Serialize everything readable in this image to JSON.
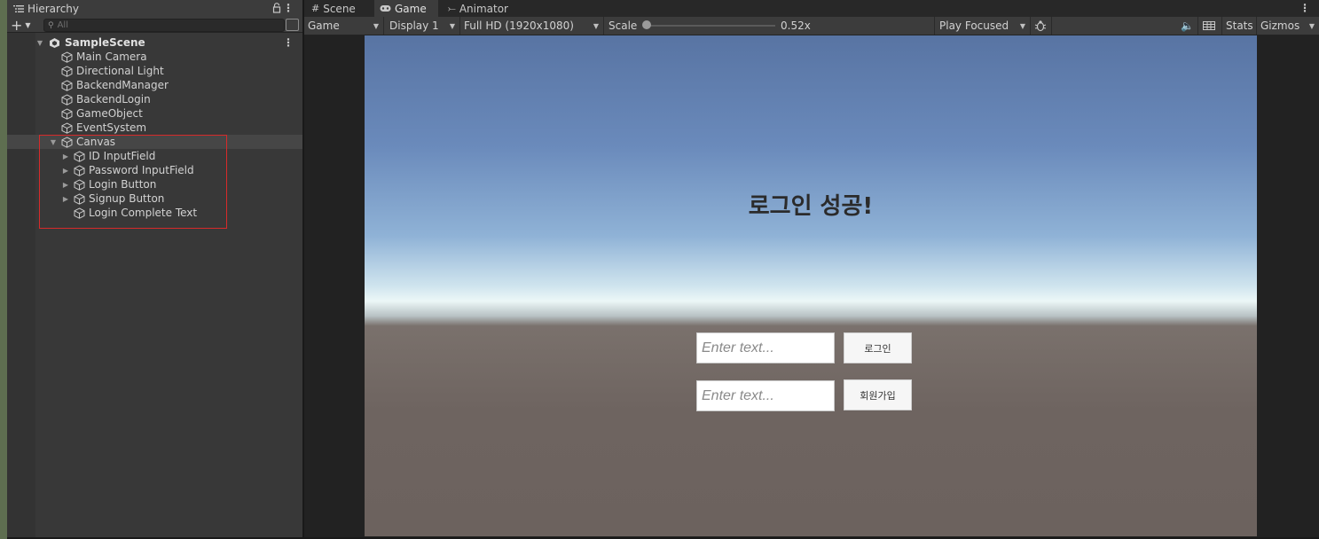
{
  "hierarchy": {
    "tab_label": "Hierarchy",
    "search_placeholder": "All",
    "scene": "SampleScene",
    "items": [
      {
        "label": "Main Camera"
      },
      {
        "label": "Directional Light"
      },
      {
        "label": "BackendManager"
      },
      {
        "label": "BackendLogin"
      },
      {
        "label": "GameObject"
      },
      {
        "label": "EventSystem"
      },
      {
        "label": "Canvas"
      }
    ],
    "canvas_children": [
      {
        "label": "ID InputField"
      },
      {
        "label": "Password InputField"
      },
      {
        "label": "Login Button"
      },
      {
        "label": "Signup Button"
      },
      {
        "label": "Login Complete Text"
      }
    ]
  },
  "tabs": {
    "scene": "Scene",
    "game": "Game",
    "animator": "Animator"
  },
  "toolbar": {
    "view_mode": "Game",
    "display": "Display 1",
    "resolution": "Full HD (1920x1080)",
    "scale_label": "Scale",
    "scale_value": "0.52x",
    "scale_fraction": 0.0,
    "play_mode": "Play Focused",
    "stats": "Stats",
    "gizmos": "Gizmos"
  },
  "game": {
    "title": "로그인 성공!",
    "id_placeholder": "Enter text...",
    "password_placeholder": "Enter text...",
    "login_button": "로그인",
    "signup_button": "회원가입"
  },
  "colors": {
    "highlight": "#d62a2a",
    "panel_bg": "#383838",
    "toolbar_bg": "#3c3c3c"
  }
}
